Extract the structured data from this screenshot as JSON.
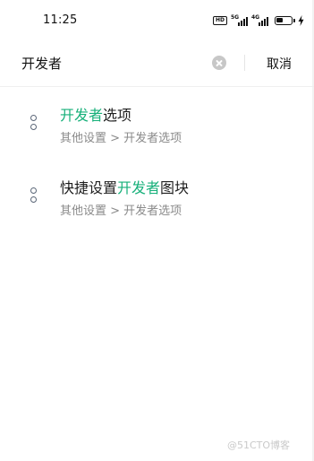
{
  "status_bar": {
    "time": "11:25",
    "hd_badge": "HD",
    "network_1": "5G",
    "network_2": "4G",
    "icons": [
      "hd-icon",
      "signal-5g-icon",
      "signal-4g-icon",
      "battery-icon",
      "charging-icon"
    ]
  },
  "search": {
    "query": "开发者",
    "cancel_label": "取消"
  },
  "results": [
    {
      "title_parts": [
        {
          "text": "开发者",
          "highlight": true
        },
        {
          "text": "选项",
          "highlight": false
        }
      ],
      "path": "其他设置 > 开发者选项",
      "icon": "settings-item-icon"
    },
    {
      "title_parts": [
        {
          "text": "快捷设置",
          "highlight": false
        },
        {
          "text": "开发者",
          "highlight": true
        },
        {
          "text": "图块",
          "highlight": false
        }
      ],
      "path": "其他设置 > 开发者选项",
      "icon": "settings-item-icon"
    }
  ],
  "watermark": "@51CTO博客",
  "colors": {
    "highlight": "#17b07a",
    "path_text": "#8a8a8a",
    "icon": "#5a6677"
  }
}
